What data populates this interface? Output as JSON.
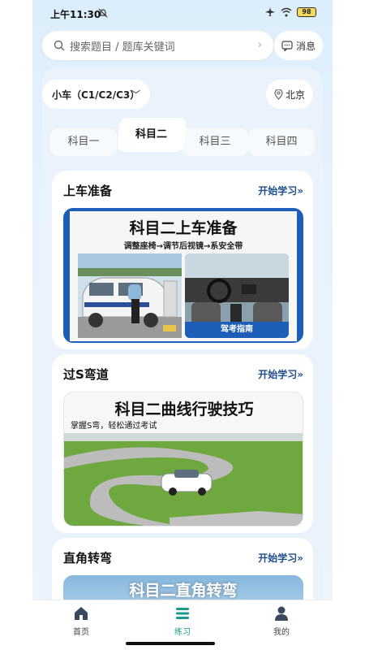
{
  "status": {
    "time": "上午11:30",
    "battery": "98"
  },
  "search": {
    "placeholder": "搜索题目 / 题库关键词"
  },
  "messages": {
    "label": "消息"
  },
  "car_type": {
    "selected": "小车（C1/C2/C3）"
  },
  "city": {
    "label": "北京"
  },
  "tabs": [
    {
      "label": "科目一"
    },
    {
      "label": "科目二"
    },
    {
      "label": "科目三"
    },
    {
      "label": "科目四"
    }
  ],
  "active_tab": "科目二",
  "sections": [
    {
      "title": "上车准备",
      "action": "开始学习»",
      "banner_title": "科目二上车准备",
      "banner_subtitle": "调整座椅→调节后视镜→系安全带",
      "banner_caption": "驾考指南"
    },
    {
      "title": "过S弯道",
      "action": "开始学习»",
      "banner_title": "科目二曲线行驶技巧",
      "banner_subtitle": "掌握S弯，轻松通过考试"
    },
    {
      "title": "直角转弯",
      "action": "开始学习»",
      "banner_title": "科目二直角转弯"
    }
  ],
  "bottom_nav": [
    {
      "label": "首页",
      "icon": "home-icon"
    },
    {
      "label": "练习",
      "icon": "practice-icon"
    },
    {
      "label": "我的",
      "icon": "profile-icon"
    }
  ],
  "colors": {
    "accent": "#1a9a8a",
    "link": "#1f4e8c",
    "banner_blue": "#1d5fb8"
  }
}
